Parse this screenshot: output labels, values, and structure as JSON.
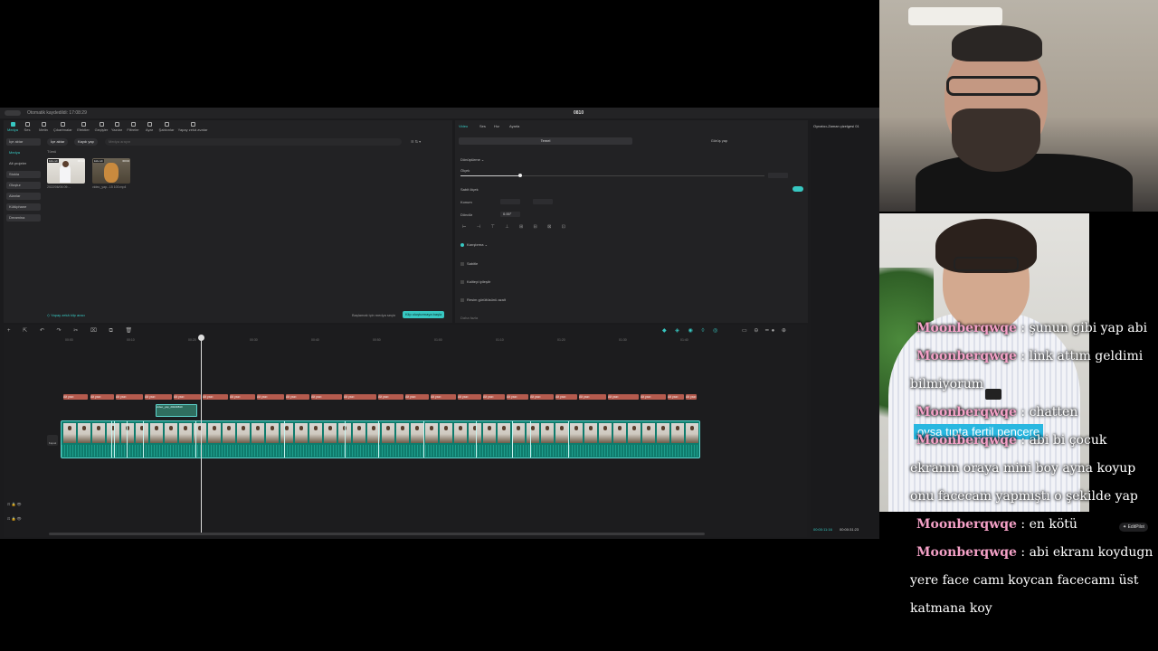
{
  "editor": {
    "autosave": "Otomatik kaydedildi: 17:08:29",
    "project": "0810",
    "toolbar": [
      "Medya",
      "Ses",
      "Metin",
      "Çıkartmalar",
      "Efektler",
      "Geçişler",
      "Yazılar",
      "Filtreler",
      "Ayar",
      "Şablonlar",
      "Yapay zekâ avatar"
    ],
    "sidebar": [
      "İçe aktar",
      "Medya",
      "Alt projeler",
      "Stokla",
      "Oluştur",
      "Alanlar",
      "Kütüphane",
      "Dreamina"
    ],
    "media_tabs": [
      "İçe aktar",
      "Kaydı yap"
    ],
    "search_placeholder": "Medya arayın",
    "media_heading": "Tümü",
    "thumbs": [
      {
        "label": "Eklendi",
        "duration": "00:11",
        "caption": "2022/06/06 09:..."
      },
      {
        "label": "Eklendi",
        "duration": "00:04",
        "caption": "video_yap...15 100.mp4"
      }
    ],
    "media_footer": "Yapay zekâ klip aracı",
    "media_footer_right": "Başlamak için medya seçin",
    "media_footer_button": "Klip oluşturmaya başla"
  },
  "props": {
    "tabs": [
      "Video",
      "Ses",
      "Hız",
      "Ayarla"
    ],
    "subtabs": [
      "Temel",
      "Görüş yap"
    ],
    "transform": "Dönüştürme",
    "scale": "Ölçek",
    "uniform": "Sabit ölçek",
    "position": "Konum",
    "rotate": "Döndür",
    "rotate_value": "0.00°",
    "blend": "Karıştırma",
    "stabilize": "Sabitle",
    "enhance": "Kaliteyi iyileştir",
    "denoise": "Resim gürültüsünü azalt",
    "more": "Daha fazla"
  },
  "player": {
    "title": "Oynatıcı-Zaman çizelgesi 01",
    "time_current": "00:00:11:16",
    "time_total": "00:00:31:23"
  },
  "timeline": {
    "ticks": [
      "00:00",
      "00:10",
      "00:20",
      "00:30",
      "00:40",
      "00:50",
      "01:00",
      "01:10",
      "01:20",
      "01:30",
      "01:40"
    ],
    "clip_label": "Alt yazı",
    "inserted_clip": "video_yap_20240810",
    "cover": "Kapak",
    "editpilot": "EditPilot"
  },
  "reel": {
    "subtitle": "oysa tıpta fertil pencere"
  },
  "chat": [
    {
      "user": "Moonberqwqe",
      "msg": ": şunun gibi yap abi"
    },
    {
      "user": "Moonberqwqe",
      "msg": ": link attım geldimi bilmiyorum"
    },
    {
      "user": "Moonberqwqe",
      "msg": ": chatten"
    },
    {
      "user": "Moonberqwqe",
      "msg": ": abi bi çocuk ekranın oraya mini boy ayna koyup onu facecam yapmıştı o şekilde yap"
    },
    {
      "user": "Moonberqwqe",
      "msg": ": en kötü"
    },
    {
      "user": "Moonberqwqe",
      "msg": ": abi ekranı koydugn yere face camı koycan facecamı üst katmana koy"
    }
  ],
  "colors": {
    "accent": "#37c7c1",
    "subtitle_clip": "#b55b4e",
    "video_clip": "#0f7b6c",
    "chat_user": "#f3a0c6"
  }
}
